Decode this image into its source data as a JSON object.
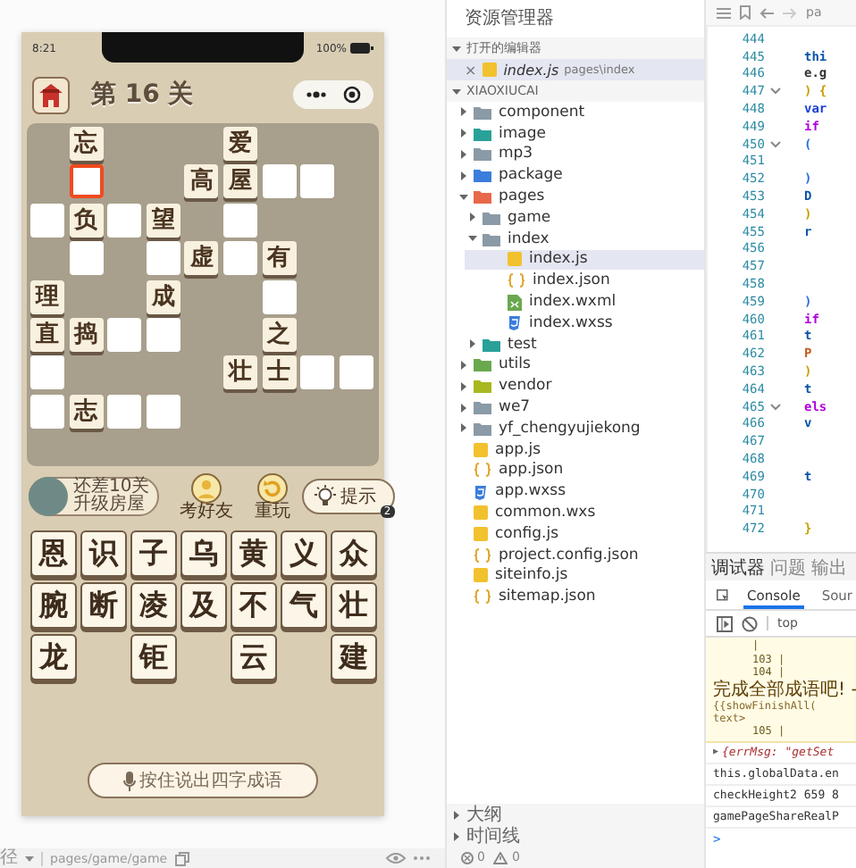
{
  "simulator": {
    "status_bar": {
      "time": "8:21",
      "battery": "100%"
    },
    "header": {
      "title": "第 16 关"
    },
    "board": {
      "rows": [
        [
          {
            "kind": "none"
          },
          {
            "kind": "tile",
            "char": "忘"
          },
          {
            "kind": "none"
          },
          {
            "kind": "none"
          },
          {
            "kind": "none"
          },
          {
            "kind": "tile",
            "char": "爱"
          },
          {
            "kind": "none"
          },
          {
            "kind": "none"
          },
          {
            "kind": "none"
          }
        ],
        [
          {
            "kind": "none"
          },
          {
            "kind": "slot",
            "selected": true
          },
          {
            "kind": "none"
          },
          {
            "kind": "none"
          },
          {
            "kind": "tile",
            "char": "高"
          },
          {
            "kind": "tile",
            "char": "屋"
          },
          {
            "kind": "slot",
            "selected": false
          },
          {
            "kind": "slot",
            "selected": false
          },
          {
            "kind": "none"
          }
        ],
        [
          {
            "kind": "slot",
            "selected": false
          },
          {
            "kind": "tile",
            "char": "负"
          },
          {
            "kind": "slot",
            "selected": false
          },
          {
            "kind": "tile",
            "char": "望"
          },
          {
            "kind": "none"
          },
          {
            "kind": "slot",
            "selected": false
          },
          {
            "kind": "none"
          },
          {
            "kind": "none"
          },
          {
            "kind": "none"
          }
        ],
        [
          {
            "kind": "none"
          },
          {
            "kind": "slot",
            "selected": false
          },
          {
            "kind": "none"
          },
          {
            "kind": "slot",
            "selected": false
          },
          {
            "kind": "tile",
            "char": "虚"
          },
          {
            "kind": "slot",
            "selected": false
          },
          {
            "kind": "tile",
            "char": "有"
          },
          {
            "kind": "none"
          },
          {
            "kind": "none"
          }
        ],
        [
          {
            "kind": "tile",
            "char": "理"
          },
          {
            "kind": "none"
          },
          {
            "kind": "none"
          },
          {
            "kind": "tile",
            "char": "成"
          },
          {
            "kind": "none"
          },
          {
            "kind": "none"
          },
          {
            "kind": "slot",
            "selected": false
          },
          {
            "kind": "none"
          },
          {
            "kind": "none"
          }
        ],
        [
          {
            "kind": "tile",
            "char": "直"
          },
          {
            "kind": "tile",
            "char": "捣"
          },
          {
            "kind": "slot",
            "selected": false
          },
          {
            "kind": "slot",
            "selected": false
          },
          {
            "kind": "none"
          },
          {
            "kind": "none"
          },
          {
            "kind": "tile",
            "char": "之"
          },
          {
            "kind": "none"
          },
          {
            "kind": "none"
          }
        ],
        [
          {
            "kind": "slot",
            "selected": false
          },
          {
            "kind": "none"
          },
          {
            "kind": "none"
          },
          {
            "kind": "none"
          },
          {
            "kind": "none"
          },
          {
            "kind": "tile",
            "char": "壮"
          },
          {
            "kind": "tile",
            "char": "士"
          },
          {
            "kind": "slot",
            "selected": false
          },
          {
            "kind": "slot",
            "selected": false
          }
        ],
        [
          {
            "kind": "slot",
            "selected": false
          },
          {
            "kind": "tile",
            "char": "志"
          },
          {
            "kind": "slot",
            "selected": false
          },
          {
            "kind": "slot",
            "selected": false
          },
          {
            "kind": "none"
          },
          {
            "kind": "none"
          },
          {
            "kind": "none"
          },
          {
            "kind": "none"
          },
          {
            "kind": "none"
          }
        ]
      ]
    },
    "progress": {
      "line1": "还差10关",
      "line2": "升级房屋"
    },
    "actions": [
      {
        "kind": "friend",
        "label": "考好友"
      },
      {
        "kind": "replay",
        "label": "重玩"
      },
      {
        "kind": "hint",
        "label": "提示",
        "badge": "2"
      }
    ],
    "pool": {
      "rows": [
        [
          {
            "kind": "tile",
            "char": "恩"
          },
          {
            "kind": "tile",
            "char": "识"
          },
          {
            "kind": "tile",
            "char": "子"
          },
          {
            "kind": "tile",
            "char": "乌"
          },
          {
            "kind": "tile",
            "char": "黄"
          },
          {
            "kind": "tile",
            "char": "义"
          },
          {
            "kind": "tile",
            "char": "众"
          }
        ],
        [
          {
            "kind": "tile",
            "char": "腕"
          },
          {
            "kind": "tile",
            "char": "断"
          },
          {
            "kind": "tile",
            "char": "凌"
          },
          {
            "kind": "tile",
            "char": "及"
          },
          {
            "kind": "tile",
            "char": "不"
          },
          {
            "kind": "tile",
            "char": "气"
          },
          {
            "kind": "tile",
            "char": "壮"
          }
        ],
        [
          {
            "kind": "tile",
            "char": "龙"
          },
          {
            "kind": "empty"
          },
          {
            "kind": "tile",
            "char": "钜"
          },
          {
            "kind": "empty"
          },
          {
            "kind": "tile",
            "char": "云"
          },
          {
            "kind": "empty"
          },
          {
            "kind": "tile",
            "char": "建"
          }
        ]
      ]
    },
    "voice_button": "按住说出四字成语",
    "path_bar": {
      "label": "径",
      "path": "pages/game/game"
    }
  },
  "explorer": {
    "title": "资源管理器",
    "open_editors": {
      "title": "打开的编辑器",
      "expanded": true,
      "items": [
        {
          "close": "×",
          "name": "index.js",
          "path": "pages\\index",
          "kind": "js",
          "selected": true
        }
      ]
    },
    "project": {
      "name": "XIAOXIUCAI",
      "expanded": true,
      "children": [
        {
          "kind": "folder",
          "name": "component",
          "color": "#8a9aa6",
          "expanded": false,
          "selected": false
        },
        {
          "kind": "folder",
          "name": "image",
          "color": "#2aa198",
          "expanded": false,
          "selected": false
        },
        {
          "kind": "folder",
          "name": "mp3",
          "color": "#8a9aa6",
          "expanded": false,
          "selected": false
        },
        {
          "kind": "folder",
          "name": "package",
          "color": "#3b7ddd",
          "expanded": false,
          "selected": false
        },
        {
          "kind": "folder",
          "name": "pages",
          "color": "#e8684a",
          "expanded": true,
          "selected": false,
          "children": [
            {
              "kind": "folder",
              "name": "game",
              "color": "#8a9aa6",
              "expanded": false,
              "selected": false
            },
            {
              "kind": "folder",
              "name": "index",
              "color": "#8a9aa6",
              "expanded": true,
              "selected": false,
              "children": [
                {
                  "kind": "js",
                  "name": "index.js",
                  "selected": true
                },
                {
                  "kind": "json",
                  "name": "index.json",
                  "selected": false
                },
                {
                  "kind": "wxml",
                  "name": "index.wxml",
                  "selected": false
                },
                {
                  "kind": "wxss",
                  "name": "index.wxss",
                  "selected": false
                }
              ]
            },
            {
              "kind": "folder",
              "name": "test",
              "color": "#2aa198",
              "expanded": false,
              "selected": false
            }
          ]
        },
        {
          "kind": "folder",
          "name": "utils",
          "color": "#6aa84f",
          "expanded": false,
          "selected": false
        },
        {
          "kind": "folder",
          "name": "vendor",
          "color": "#a8b820",
          "expanded": false,
          "selected": false
        },
        {
          "kind": "folder",
          "name": "we7",
          "color": "#8a9aa6",
          "expanded": false,
          "selected": false
        },
        {
          "kind": "folder",
          "name": "yf_chengyujiekong",
          "color": "#8a9aa6",
          "expanded": false,
          "selected": false
        },
        {
          "kind": "js",
          "name": "app.js",
          "selected": false
        },
        {
          "kind": "json",
          "name": "app.json",
          "selected": false
        },
        {
          "kind": "wxss",
          "name": "app.wxss",
          "selected": false
        },
        {
          "kind": "js",
          "name": "common.wxs",
          "selected": false
        },
        {
          "kind": "js",
          "name": "config.js",
          "selected": false
        },
        {
          "kind": "json",
          "name": "project.config.json",
          "selected": false
        },
        {
          "kind": "js",
          "name": "siteinfo.js",
          "selected": false
        },
        {
          "kind": "json",
          "name": "sitemap.json",
          "selected": false
        }
      ]
    },
    "footer_sections": [
      {
        "title": "大纲",
        "expanded": false
      },
      {
        "title": "时间线",
        "expanded": false
      }
    ],
    "problems": {
      "errors": "0",
      "warnings": "0"
    }
  },
  "editor": {
    "breadcrumb": "pa",
    "lines": [
      {
        "number": "444"
      },
      {
        "number": "445",
        "code": "thi",
        "color": "#0b55a8"
      },
      {
        "number": "446",
        "code": "e.g",
        "color": "#333333"
      },
      {
        "number": "447",
        "code": ") {",
        "color": "#c9a000",
        "fold": true
      },
      {
        "number": "448",
        "code": "var",
        "color": "#1a3fd8"
      },
      {
        "number": "449",
        "code": "if",
        "color": "#af00db"
      },
      {
        "number": "450",
        "code": "(",
        "color": "#2a6fe0",
        "fold": true
      },
      {
        "number": "451"
      },
      {
        "number": "452",
        "code": ")",
        "color": "#2a6fe0"
      },
      {
        "number": "453",
        "code": "D",
        "color": "#0b55a8"
      },
      {
        "number": "454",
        "code": ")",
        "color": "#c9a000"
      },
      {
        "number": "455",
        "code": "r",
        "color": "#0b55a8"
      },
      {
        "number": "456"
      },
      {
        "number": "457"
      },
      {
        "number": "458"
      },
      {
        "number": "459",
        "code": ")",
        "color": "#2a6fe0"
      },
      {
        "number": "460",
        "code": "if",
        "color": "#af00db"
      },
      {
        "number": "461",
        "code": "t",
        "color": "#0b55a8"
      },
      {
        "number": "462",
        "code": "P",
        "color": "#c45a1a"
      },
      {
        "number": "463",
        "code": ")",
        "color": "#c9a000"
      },
      {
        "number": "464",
        "code": "t",
        "color": "#0b55a8"
      },
      {
        "number": "465",
        "code": "els",
        "color": "#af00db",
        "fold": true
      },
      {
        "number": "466",
        "code": "v",
        "color": "#0b55a8"
      },
      {
        "number": "467"
      },
      {
        "number": "468"
      },
      {
        "number": "469",
        "code": "t",
        "color": "#0b55a8"
      },
      {
        "number": "470"
      },
      {
        "number": "471"
      },
      {
        "number": "472",
        "code": "}",
        "color": "#c9a000"
      }
    ]
  },
  "console": {
    "tabs": [
      {
        "label": "调试器",
        "selected": true
      },
      {
        "label": "问题",
        "selected": false
      },
      {
        "label": "输出",
        "selected": false
      }
    ],
    "subtabs": [
      {
        "label": "Console",
        "selected": true
      },
      {
        "label": "Sour",
        "selected": false
      }
    ],
    "context": "top",
    "warning_lines": [
      {
        "kind": "gutter",
        "text": "|"
      },
      {
        "kind": "gutter",
        "text": "103 |"
      },
      {
        "kind": "gutter",
        "text": "104 |"
      },
      {
        "kind": "message",
        "text": "完成全部成语吧! -"
      },
      {
        "kind": "code",
        "text": "{{showFinishAll("
      },
      {
        "kind": "code",
        "text": "text>"
      },
      {
        "kind": "gutter",
        "text": "105 |"
      }
    ],
    "messages": [
      {
        "kind": "object",
        "arrow": "▶",
        "text": "{errMsg: \"getSet"
      },
      {
        "kind": "log",
        "text": "this.globalData.en"
      },
      {
        "kind": "log",
        "text": "checkHeight2 659 8"
      },
      {
        "kind": "log",
        "text": "gamePageShareRealP"
      }
    ],
    "prompt": ">"
  }
}
